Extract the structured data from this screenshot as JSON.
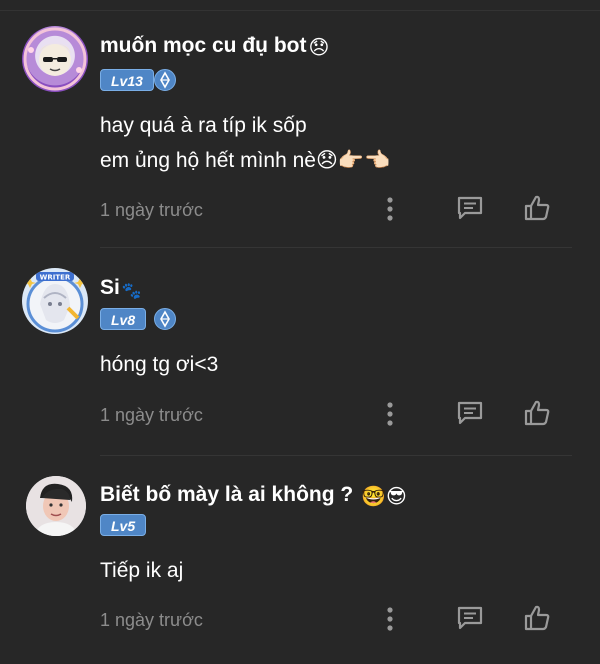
{
  "comments": [
    {
      "name": "muốn mọc cu đụ bot",
      "name_emoji": "😞",
      "level": "Lv13",
      "has_vip_badge": true,
      "text": "hay quá à ra típ ik sốp\nem ủng hộ hết mình nè😞👉🏻👈🏻",
      "time": "1 ngày trước",
      "avatar_icon": "avatar-sunglasses-frame"
    },
    {
      "name": "Si",
      "name_emoji": "🐾",
      "level": "Lv8",
      "has_vip_badge": true,
      "text": "hóng tg ơi<3",
      "time": "1 ngày trước",
      "avatar_icon": "avatar-writer-frame",
      "avatar_badge_text": "WRITER"
    },
    {
      "name": "Biết bố mày là ai không ?",
      "name_emoji": "🤓😎",
      "level": "Lv5",
      "has_vip_badge": false,
      "text": "Tiếp ik aj",
      "time": "1 ngày trước",
      "avatar_icon": "avatar-photo"
    }
  ],
  "actions": {
    "more_icon": "more-vertical-icon",
    "reply_icon": "comment-icon",
    "like_icon": "thumbs-up-icon"
  },
  "colors": {
    "background": "#272727",
    "level_badge": "#4f86c6",
    "time_text": "#8c8c8c"
  }
}
